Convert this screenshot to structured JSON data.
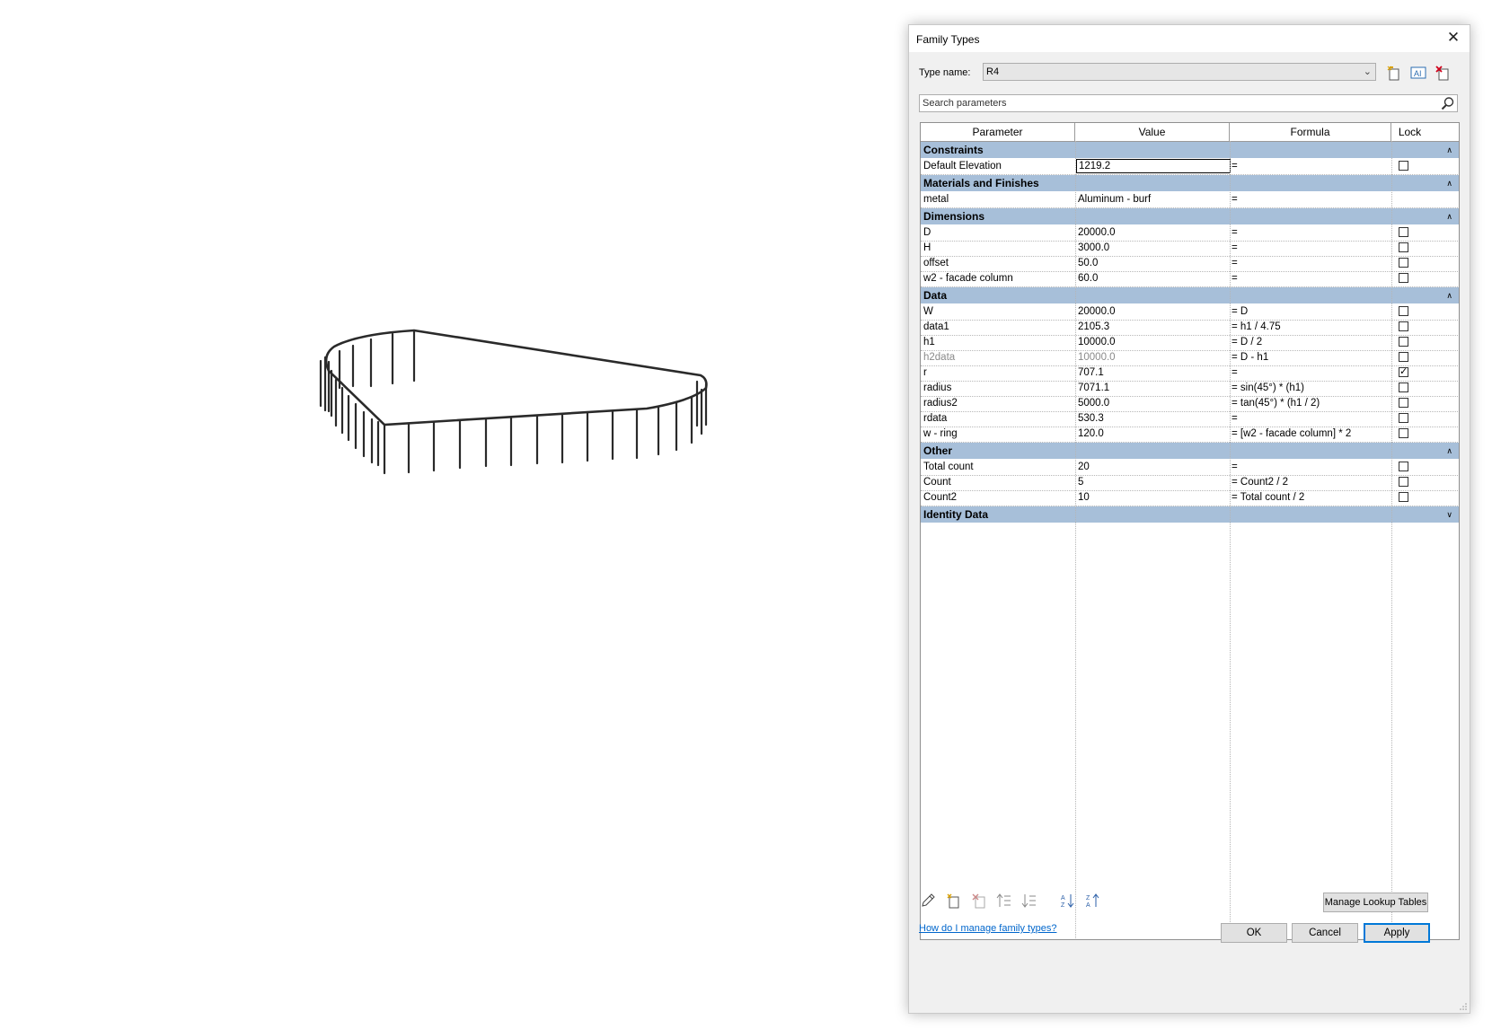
{
  "dialog": {
    "title": "Family Types",
    "type_name_label": "Type name:",
    "type_name_value": "R4",
    "search_placeholder": "Search parameters",
    "columns": [
      "Parameter",
      "Value",
      "Formula",
      "Lock"
    ],
    "groups": [
      {
        "name": "Constraints",
        "rows": [
          {
            "param": "Default Elevation",
            "value": "1219.2",
            "formula": "=",
            "lock": false,
            "editing": true
          }
        ]
      },
      {
        "name": "Materials and Finishes",
        "rows": [
          {
            "param": "metal",
            "value": "Aluminum - burf",
            "formula": "=",
            "lock": null
          }
        ]
      },
      {
        "name": "Dimensions",
        "rows": [
          {
            "param": "D",
            "value": "20000.0",
            "formula": "=",
            "lock": false
          },
          {
            "param": "H",
            "value": "3000.0",
            "formula": "=",
            "lock": false
          },
          {
            "param": "offset",
            "value": "50.0",
            "formula": "=",
            "lock": false
          },
          {
            "param": "w2 -  facade column",
            "value": "60.0",
            "formula": "=",
            "lock": false
          }
        ]
      },
      {
        "name": "Data",
        "rows": [
          {
            "param": "W",
            "value": "20000.0",
            "formula": "= D",
            "lock": false
          },
          {
            "param": "data1",
            "value": "2105.3",
            "formula": "= h1 / 4.75",
            "lock": false
          },
          {
            "param": "h1",
            "value": "10000.0",
            "formula": "= D / 2",
            "lock": false
          },
          {
            "param": "h2data",
            "value": "10000.0",
            "formula": "= D - h1",
            "lock": false,
            "disabled": true
          },
          {
            "param": "r",
            "value": "707.1",
            "formula": "=",
            "lock": true
          },
          {
            "param": "radius",
            "value": "7071.1",
            "formula": "= sin(45°) * (h1)",
            "lock": false
          },
          {
            "param": "radius2",
            "value": "5000.0",
            "formula": "= tan(45°) * (h1 / 2)",
            "lock": false
          },
          {
            "param": "rdata",
            "value": "530.3",
            "formula": "=",
            "lock": false
          },
          {
            "param": "w - ring",
            "value": "120.0",
            "formula": "= [w2 -  facade column] * 2",
            "lock": false
          }
        ]
      },
      {
        "name": "Other",
        "rows": [
          {
            "param": "Total count",
            "value": "20",
            "formula": "=",
            "lock": false
          },
          {
            "param": "Count",
            "value": "5",
            "formula": "= Count2 / 2",
            "lock": false
          },
          {
            "param": "Count2",
            "value": "10",
            "formula": "= Total count / 2",
            "lock": false
          }
        ]
      },
      {
        "name": "Identity Data",
        "rows": [],
        "collapsed": true
      }
    ],
    "manage_lookup_label": "Manage Lookup Tables",
    "help_link": "How do I manage family types?",
    "ok_label": "OK",
    "cancel_label": "Cancel",
    "apply_label": "Apply",
    "icons": {
      "new_type": "new-type-icon",
      "rename_type": "rename-type-icon",
      "delete_type": "delete-type-icon",
      "search": "search-icon",
      "edit_param": "pencil-icon",
      "new_param": "new-parameter-icon",
      "delete_param": "delete-parameter-icon",
      "move_up": "move-up-icon",
      "move_down": "move-down-icon",
      "sort_asc": "sort-ascending-icon",
      "sort_desc": "sort-descending-icon"
    }
  }
}
